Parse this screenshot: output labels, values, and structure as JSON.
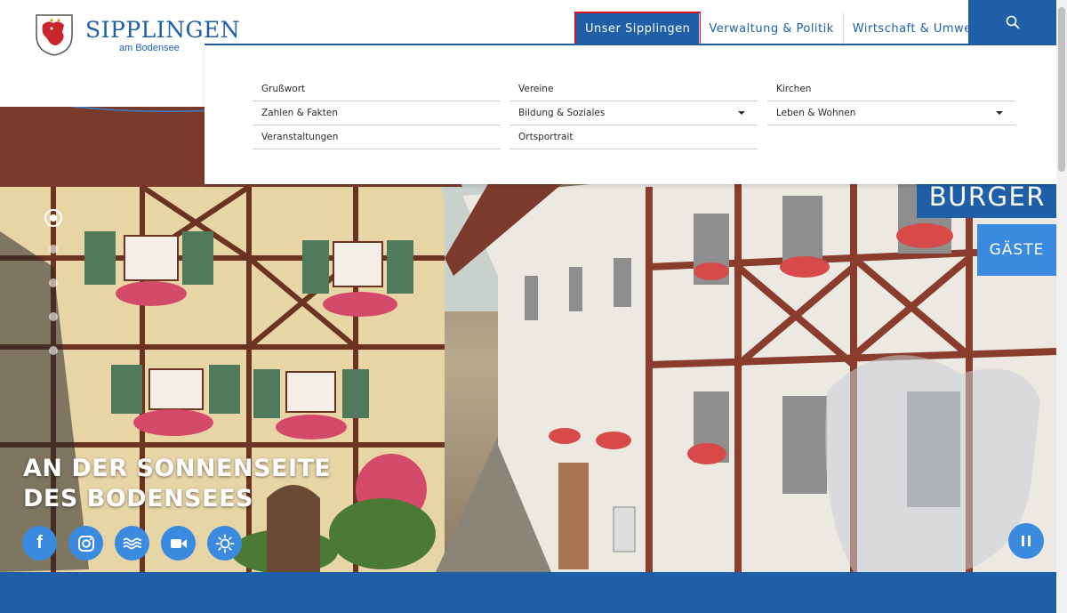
{
  "logo": {
    "title": "SIPPLINGEN",
    "subtitle": "am Bodensee"
  },
  "nav": {
    "items": [
      {
        "label": "Unser Sipplingen",
        "active": true
      },
      {
        "label": "Verwaltung & Politik",
        "active": false
      },
      {
        "label": "Wirtschaft & Umwelt",
        "active": false
      }
    ],
    "search_icon": "search-icon"
  },
  "dropdown": {
    "columns": [
      [
        {
          "label": "Grußwort",
          "has_submenu": false
        },
        {
          "label": "Zahlen & Fakten",
          "has_submenu": false
        },
        {
          "label": "Veranstaltungen",
          "has_submenu": false
        }
      ],
      [
        {
          "label": "Vereine",
          "has_submenu": false
        },
        {
          "label": "Bildung & Soziales",
          "has_submenu": true
        },
        {
          "label": "Ortsportrait",
          "has_submenu": false
        }
      ],
      [
        {
          "label": "Kirchen",
          "has_submenu": false
        },
        {
          "label": "Leben & Wohnen",
          "has_submenu": true
        }
      ]
    ]
  },
  "hero": {
    "title_line1": "AN DER SONNENSEITE",
    "title_line2": "DES BODENSEES",
    "slides_total": 5,
    "active_slide": 1
  },
  "side_buttons": {
    "burger": "BÜRGER",
    "gaeste": "GÄSTE"
  },
  "social": [
    {
      "icon": "facebook-icon",
      "glyph": "f"
    },
    {
      "icon": "instagram-icon"
    },
    {
      "icon": "waves-icon"
    },
    {
      "icon": "webcam-icon"
    },
    {
      "icon": "weather-sun-icon"
    }
  ],
  "colors": {
    "brand_blue": "#1f5fa8",
    "accent_blue": "#3a8ae0",
    "active_outline": "#d2151e"
  }
}
